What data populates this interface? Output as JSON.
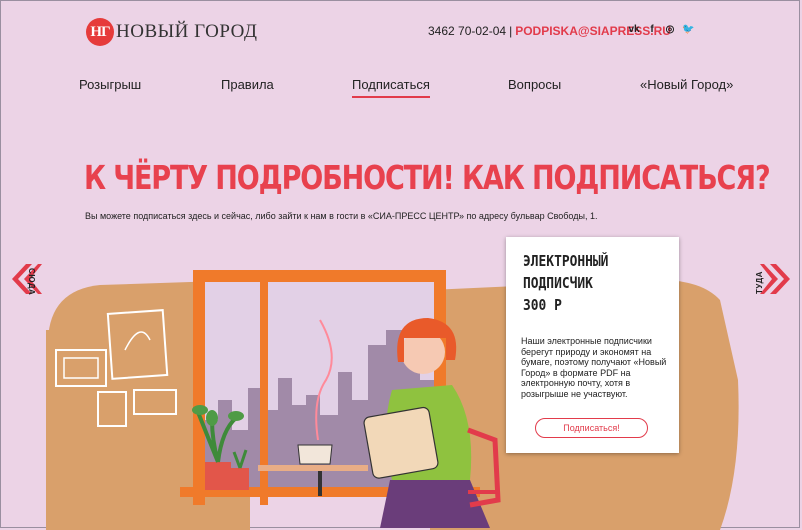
{
  "logo": {
    "mark": "НГ",
    "text": "НОВЫЙ ГОРОД"
  },
  "header": {
    "phone": "3462 70-02-04",
    "separator": "|",
    "email": "PODPISKA@SIAPRESS.RU"
  },
  "social": [
    {
      "icon": "vk-icon",
      "glyph": "vk"
    },
    {
      "icon": "facebook-icon",
      "glyph": "f"
    },
    {
      "icon": "instagram-icon",
      "glyph": "◎"
    },
    {
      "icon": "twitter-icon",
      "glyph": "🐦"
    }
  ],
  "nav": [
    {
      "label": "Розыгрыш"
    },
    {
      "label": "Правила"
    },
    {
      "label": "Подписаться",
      "active": true
    },
    {
      "label": "Вопросы"
    },
    {
      "label": "«Новый Город»"
    }
  ],
  "hero": {
    "title": "К ЧЁРТУ ПОДРОБНОСТИ! КАК ПОДПИСАТЬСЯ?",
    "subtitle": "Вы можете подписаться здесь и сейчас, либо зайти к нам в гости в «СИА-ПРЕСС ЦЕНТР» по адресу бульвар Свободы, 1."
  },
  "arrows": {
    "left_label": "СЮДА",
    "right_label": "ТУДА"
  },
  "card": {
    "title_line1": "ЭЛЕКТРОННЫЙ",
    "title_line2": "ПОДПИСЧИК",
    "price": "300 Р",
    "text": "Наши электронные подписчики берегут природу и экономят на бумаге, поэтому получают «Новый Город» в формате PDF на электронную почту, хотя в розыгрыше не участвуют.",
    "button": "Подписаться!"
  },
  "colors": {
    "accent": "#e23b4b",
    "background": "#ecd3e6",
    "sofa": "#d9a06b",
    "window_frame": "#f07a2a",
    "sky": "#e2d0e6"
  }
}
